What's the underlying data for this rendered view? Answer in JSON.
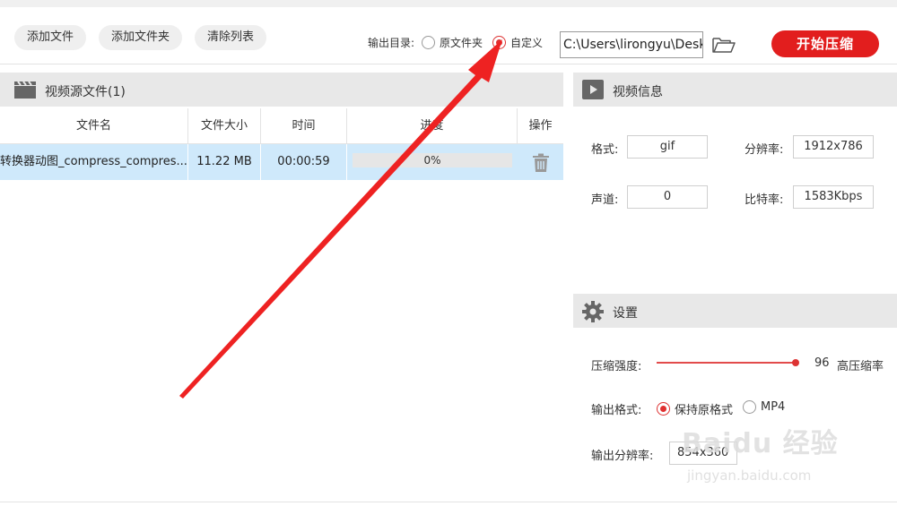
{
  "toolbar": {
    "add_file": "添加文件",
    "add_folder": "添加文件夹",
    "clear_list": "清除列表",
    "output_dir_label": "输出目录:",
    "option_source_folder": "原文件夹",
    "option_custom": "自定义",
    "selected_option": "自定义",
    "output_path": "C:\\Users\\lirongyu\\Desk",
    "start_button": "开始压缩",
    "accent_color": "#e21e1e"
  },
  "file_list": {
    "title": "视频源文件(1)",
    "columns": [
      "文件名",
      "文件大小",
      "时间",
      "进度",
      "操作"
    ],
    "rows": [
      {
        "filename": "转换器动图_compress_compres...",
        "size": "11.22 MB",
        "duration": "00:00:59",
        "progress": "0%",
        "progress_value": 0
      }
    ]
  },
  "video_info": {
    "title": "视频信息",
    "format_label": "格式:",
    "format_value": "gif",
    "resolution_label": "分辨率:",
    "resolution_value": "1912x786",
    "channel_label": "声道:",
    "channel_value": "0",
    "bitrate_label": "比特率:",
    "bitrate_value": "1583Kbps"
  },
  "settings": {
    "title": "设置",
    "compression_label": "压缩强度:",
    "compression_value": "96",
    "compression_value_fraction": 0.96,
    "compression_desc": "高压缩率",
    "output_format_label": "输出格式:",
    "format_option_keep": "保持原格式",
    "format_option_mp4": "MP4",
    "selected_format": "保持原格式",
    "output_resolution_label": "输出分辨率:",
    "output_resolution_value": "854x360"
  },
  "watermark": {
    "brand": "Baidu 经验",
    "url": "jingyan.baidu.com"
  },
  "icons": {
    "header_video": "film-clapper-icon",
    "folder": "folder-open-icon",
    "trash": "trash-icon",
    "play": "play-icon",
    "gear": "gear-icon"
  },
  "annotation": {
    "arrow_color": "#ee2222"
  }
}
